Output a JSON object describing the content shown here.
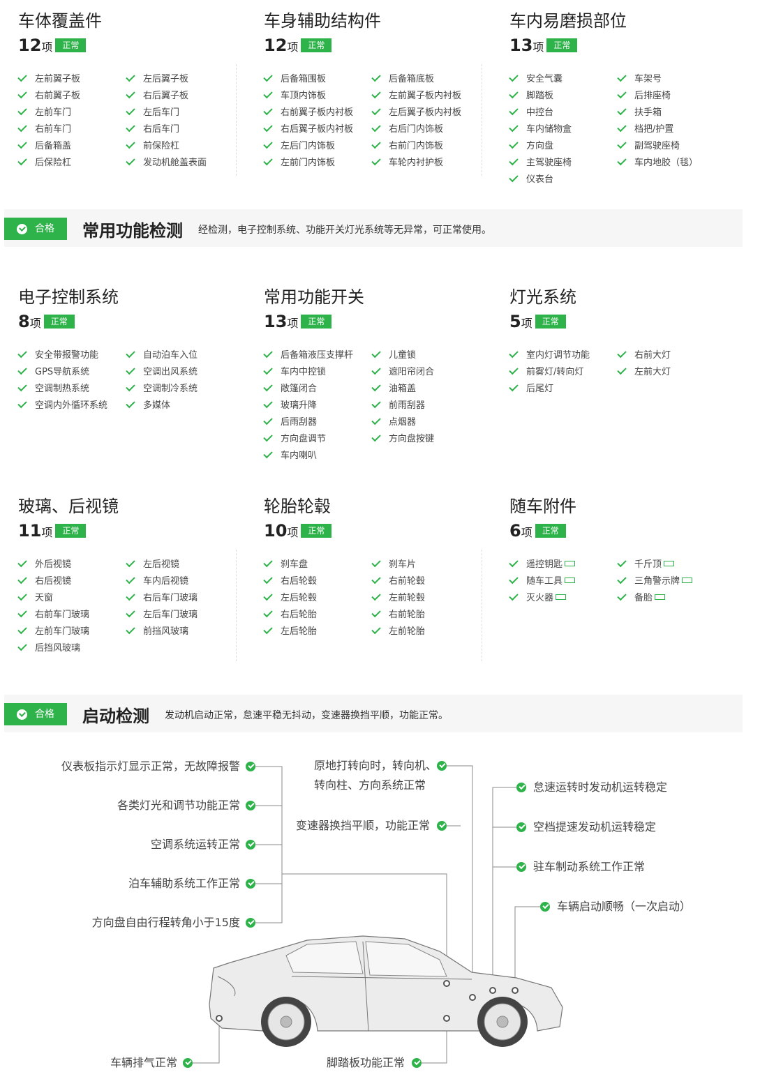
{
  "badge_normal": "正常",
  "unit": "项",
  "colors": {
    "accent": "#2eb24a"
  },
  "sections": {
    "body_cover": {
      "title": "车体覆盖件",
      "count": "12",
      "items": [
        "左前翼子板",
        "左后翼子板",
        "右前翼子板",
        "右后翼子板",
        "左前车门",
        "左后车门",
        "右前车门",
        "右后车门",
        "后备箱盖",
        "前保险杠",
        "后保险杠",
        "发动机舱盖表面"
      ]
    },
    "body_aux": {
      "title": "车身辅助结构件",
      "count": "12",
      "items": [
        "后备箱围板",
        "后备箱底板",
        "车顶内饰板",
        "左前翼子板内衬板",
        "右前翼子板内衬板",
        "左后翼子板内衬板",
        "右后翼子板内衬板",
        "右后门内饰板",
        "左后门内饰板",
        "右前门内饰板",
        "左前门内饰板",
        "车轮内衬护板"
      ]
    },
    "interior_wear": {
      "title": "车内易磨损部位",
      "count": "13",
      "items": [
        "安全气囊",
        "车架号",
        "脚踏板",
        "后排座椅",
        "中控台",
        "扶手箱",
        "车内储物盒",
        "档把/护置",
        "方向盘",
        "副驾驶座椅",
        "主驾驶座椅",
        "车内地胶（毯）",
        "仪表台"
      ]
    },
    "electronic": {
      "title": "电子控制系统",
      "count": "8",
      "items": [
        "安全带报警功能",
        "自动泊车入位",
        "GPS导航系统",
        "空调出风系统",
        "空调制热系统",
        "空调制冷系统",
        "空调内外循环系统",
        "多媒体"
      ]
    },
    "switches": {
      "title": "常用功能开关",
      "count": "13",
      "items": [
        "后备箱液压支撑杆",
        "儿童锁",
        "车内中控锁",
        "遮阳帘闭合",
        "敞篷闭合",
        "油箱盖",
        "玻璃升降",
        "前雨刮器",
        "后雨刮器",
        "点烟器",
        "方向盘调节",
        "方向盘按键",
        "车内喇叭"
      ]
    },
    "lights": {
      "title": "灯光系统",
      "count": "5",
      "items": [
        "室内灯调节功能",
        "右前大灯",
        "前雾灯/转向灯",
        "左前大灯",
        "后尾灯"
      ]
    },
    "glass": {
      "title": "玻璃、后视镜",
      "count": "11",
      "items": [
        "外后视镜",
        "左后视镜",
        "右后视镜",
        "车内后视镜",
        "天窗",
        "右后车门玻璃",
        "右前车门玻璃",
        "左后车门玻璃",
        "左前车门玻璃",
        "前挡风玻璃",
        "后挡风玻璃"
      ]
    },
    "tires": {
      "title": "轮胎轮毂",
      "count": "10",
      "items": [
        "刹车盘",
        "刹车片",
        "右后轮毂",
        "右前轮毂",
        "左后轮毂",
        "左前轮毂",
        "右后轮胎",
        "右前轮胎",
        "左后轮胎",
        "左前轮胎"
      ]
    },
    "accessories": {
      "title": "随车附件",
      "count": "6",
      "items": [
        "遥控钥匙",
        "千斤顶",
        "随车工具",
        "三角警示牌",
        "灭火器",
        "备胎"
      ]
    }
  },
  "banner1": {
    "status": "合格",
    "title": "常用功能检测",
    "desc": "经检测，电子控制系统、功能开关灯光系统等无异常，可正常使用。"
  },
  "banner2": {
    "status": "合格",
    "title": "启动检测",
    "desc": "发动机启动正常，怠速平稳无抖动，变速器换挡平顺，功能正常。"
  },
  "startup": {
    "left": [
      "仪表板指示灯显示正常，无故障报警",
      "各类灯光和调节功能正常",
      "空调系统运转正常",
      "泊车辅助系统工作正常",
      "方向盘自由行程转角小于15度"
    ],
    "mid1_line1": "原地打转向时，转向机、",
    "mid1_line2": "转向柱、方向系统正常",
    "mid2": "变速器换挡平顺，功能正常",
    "right": [
      "怠速运转时发动机运转稳定",
      "空档提速发动机运转稳定",
      "驻车制动系统工作正常",
      "车辆启动顺畅（一次启动）"
    ],
    "exhaust": "车辆排气正常",
    "pedal": "脚踏板功能正常"
  }
}
